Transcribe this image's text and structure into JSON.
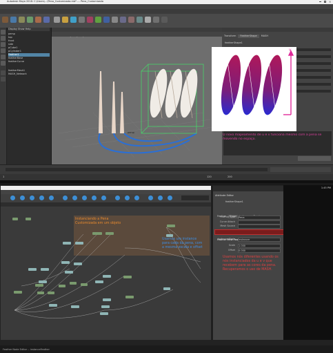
{
  "maya": {
    "title": "Autodesk Maya 2018: C:\\Users\\...\\Pena_Customizada.mb*  ---  Pena_Customizada",
    "menus": [
      "File",
      "Edit",
      "Create",
      "Select",
      "Modify",
      "Display",
      "Windows",
      "Mesh",
      "Edit Mesh",
      "Mesh Tools",
      "Mesh Display",
      "Curves",
      "Surfaces",
      "Deform",
      "UV",
      "Generate",
      "Cache",
      "Arnold",
      "Help"
    ],
    "shelf_tabs": [
      "Curves / Surfaces",
      "Poly Modeling",
      "Sculpting",
      "Rigging",
      "Animation",
      "Rendering",
      "FX",
      "FX Caching",
      "Custom",
      "Arnold",
      "Bifrost",
      "MASH",
      "Motion Graphics",
      "XGen"
    ],
    "outliner_items": [
      "persp",
      "top",
      "front",
      "side",
      "pCube1",
      "pCylinder1",
      "Feather1",
      "featherBase",
      "featherCurve",
      "featherMesh1",
      "MASH_Network"
    ],
    "viewport_menus": [
      "View",
      "Shading",
      "Lighting",
      "Show",
      "Renderer",
      "Panels"
    ],
    "viewport_camera": "persp",
    "attr_tabs": [
      "Transform",
      "FeatherShape",
      "MASH"
    ],
    "attr_header": "featherShape1",
    "timeline_start": "1",
    "timeline_end": "120",
    "range_start": "1",
    "range_end": "200"
  },
  "inset_caption": "O novo mapeamento de u e v funciona mesmo com a pena se movendo no espaço.",
  "node_editor": {
    "title": "Node Editor",
    "menus": [
      "Edit",
      "View",
      "Graph",
      "Window",
      "Options",
      "Help"
    ],
    "tab": "Untitled_1",
    "group_label": "Instanciando a Pena\nCustomizada em um objeto",
    "annotation_blue": "Usamos um instance para cada da pena, com a mesma escala e offset",
    "status": "Feather Node Editor -- instanceFeather"
  },
  "attr_dialog": {
    "title": "Attribute Editor",
    "node_name": "featherShape1",
    "tabs": [
      "Feather",
      "Shape",
      "Instancer",
      "Render"
    ],
    "rows": [
      {
        "label": "Feather Type",
        "value": "Pena"
      },
      {
        "label": "Curve Attach",
        "value": ""
      },
      {
        "label": "Mesh Source",
        "value": ""
      },
      {
        "label": "Instance Mode",
        "value": "Instancer"
      },
      {
        "label": "Scale",
        "value": "1.000"
      },
      {
        "label": "Offset",
        "value": "0.000"
      }
    ],
    "highlight_label": "Feather Mesh  featherMesh1",
    "note": "Usamos nós diferentes usando os nós instanciados da u e v que recebem para as cores da pena. Recuperamos o uso de MASH."
  },
  "clock": "1:45 PM"
}
